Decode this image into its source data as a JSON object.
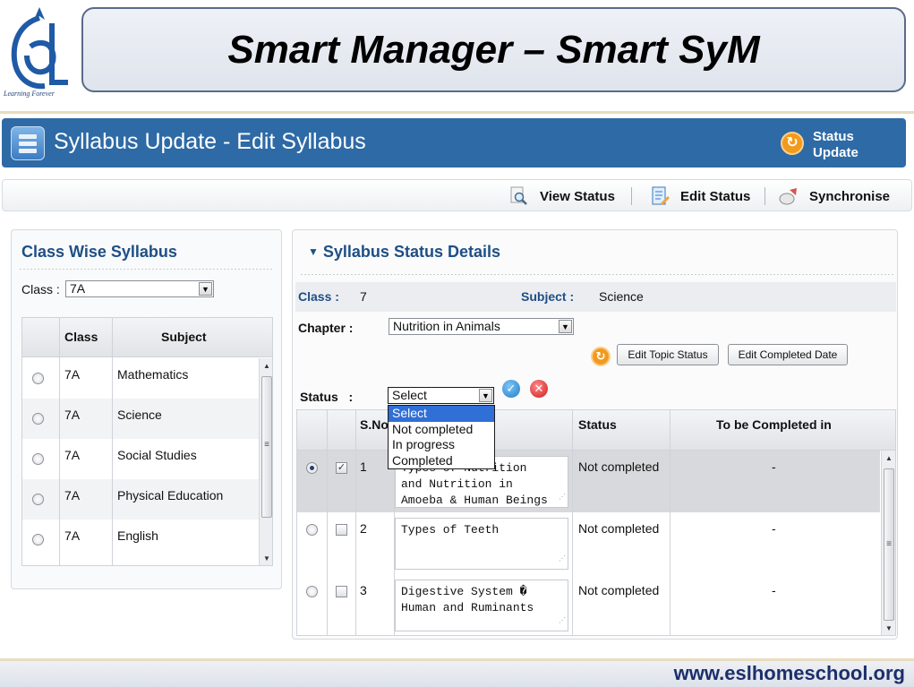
{
  "logo": {
    "tagline": "Learning Forever"
  },
  "banner": {
    "title": "Smart Manager – Smart SyM"
  },
  "header": {
    "title": "Syllabus Update - Edit Syllabus",
    "status_update": "Status Update"
  },
  "toolbar": {
    "view_status": "View Status",
    "edit_status": "Edit Status",
    "synchronise": "Synchronise"
  },
  "left_panel": {
    "heading": "Class Wise Syllabus",
    "class_label": "Class :",
    "class_value": "7A",
    "columns": [
      "Class",
      "Subject"
    ],
    "rows": [
      {
        "class": "7A",
        "subject": "Mathematics"
      },
      {
        "class": "7A",
        "subject": "Science"
      },
      {
        "class": "7A",
        "subject": "Social Studies"
      },
      {
        "class": "7A",
        "subject": "Physical Education"
      },
      {
        "class": "7A",
        "subject": "English"
      }
    ]
  },
  "right_panel": {
    "heading": "Syllabus Status Details",
    "class_label": "Class :",
    "class_value": "7",
    "subject_label": "Subject :",
    "subject_value": "Science",
    "chapter_label": "Chapter :",
    "chapter_value": "Nutrition in Animals",
    "edit_topic_status": "Edit Topic Status",
    "edit_completed_date": "Edit Completed Date",
    "status_label": "Status   :",
    "status_value": "Select",
    "status_options": [
      "Select",
      "Not completed",
      "In progress",
      "Completed"
    ],
    "columns": {
      "sno": "S.No",
      "status": "Status",
      "to_be_completed": "To be Completed in"
    },
    "rows": [
      {
        "sno": "1",
        "topic_lines": [
          "Types of Nutrition",
          "and Nutrition in",
          "Amoeba & Human Beings"
        ],
        "status": "Not completed",
        "due": "-"
      },
      {
        "sno": "2",
        "topic_lines": [
          "Types of Teeth"
        ],
        "status": "Not completed",
        "due": "-"
      },
      {
        "sno": "3",
        "topic_lines": [
          "Digestive System �",
          "Human and Ruminants"
        ],
        "status": "Not completed",
        "due": "-"
      }
    ]
  },
  "footer": {
    "url": "www.eslhomeschool.org"
  },
  "colors": {
    "header_blue": "#2e6aa6",
    "heading_blue": "#1e4f86",
    "dropdown_highlight": "#2f6fd6"
  }
}
